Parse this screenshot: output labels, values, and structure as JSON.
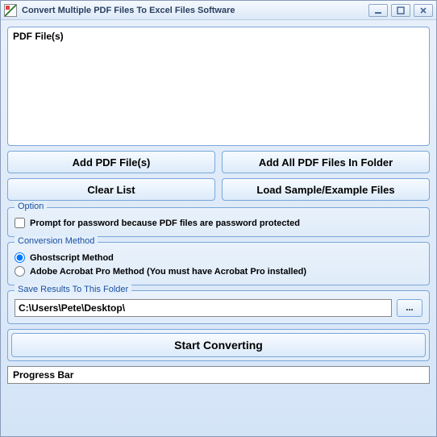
{
  "window": {
    "title": "Convert Multiple PDF Files To Excel Files Software"
  },
  "fileList": {
    "header": "PDF File(s)"
  },
  "buttons": {
    "addPdf": "Add PDF File(s)",
    "addFolder": "Add All PDF Files In Folder",
    "clearList": "Clear List",
    "loadSample": "Load Sample/Example Files",
    "browse": "...",
    "start": "Start Converting"
  },
  "option": {
    "legend": "Option",
    "promptPassword": "Prompt for password because PDF files are password protected",
    "promptPasswordChecked": false
  },
  "conversion": {
    "legend": "Conversion Method",
    "ghostscript": "Ghostscript Method",
    "acrobat": "Adobe Acrobat Pro Method (You must have Acrobat Pro installed)",
    "selected": "ghostscript"
  },
  "save": {
    "legend": "Save Results To This Folder",
    "path": "C:\\Users\\Pete\\Desktop\\"
  },
  "progress": {
    "label": "Progress Bar"
  }
}
